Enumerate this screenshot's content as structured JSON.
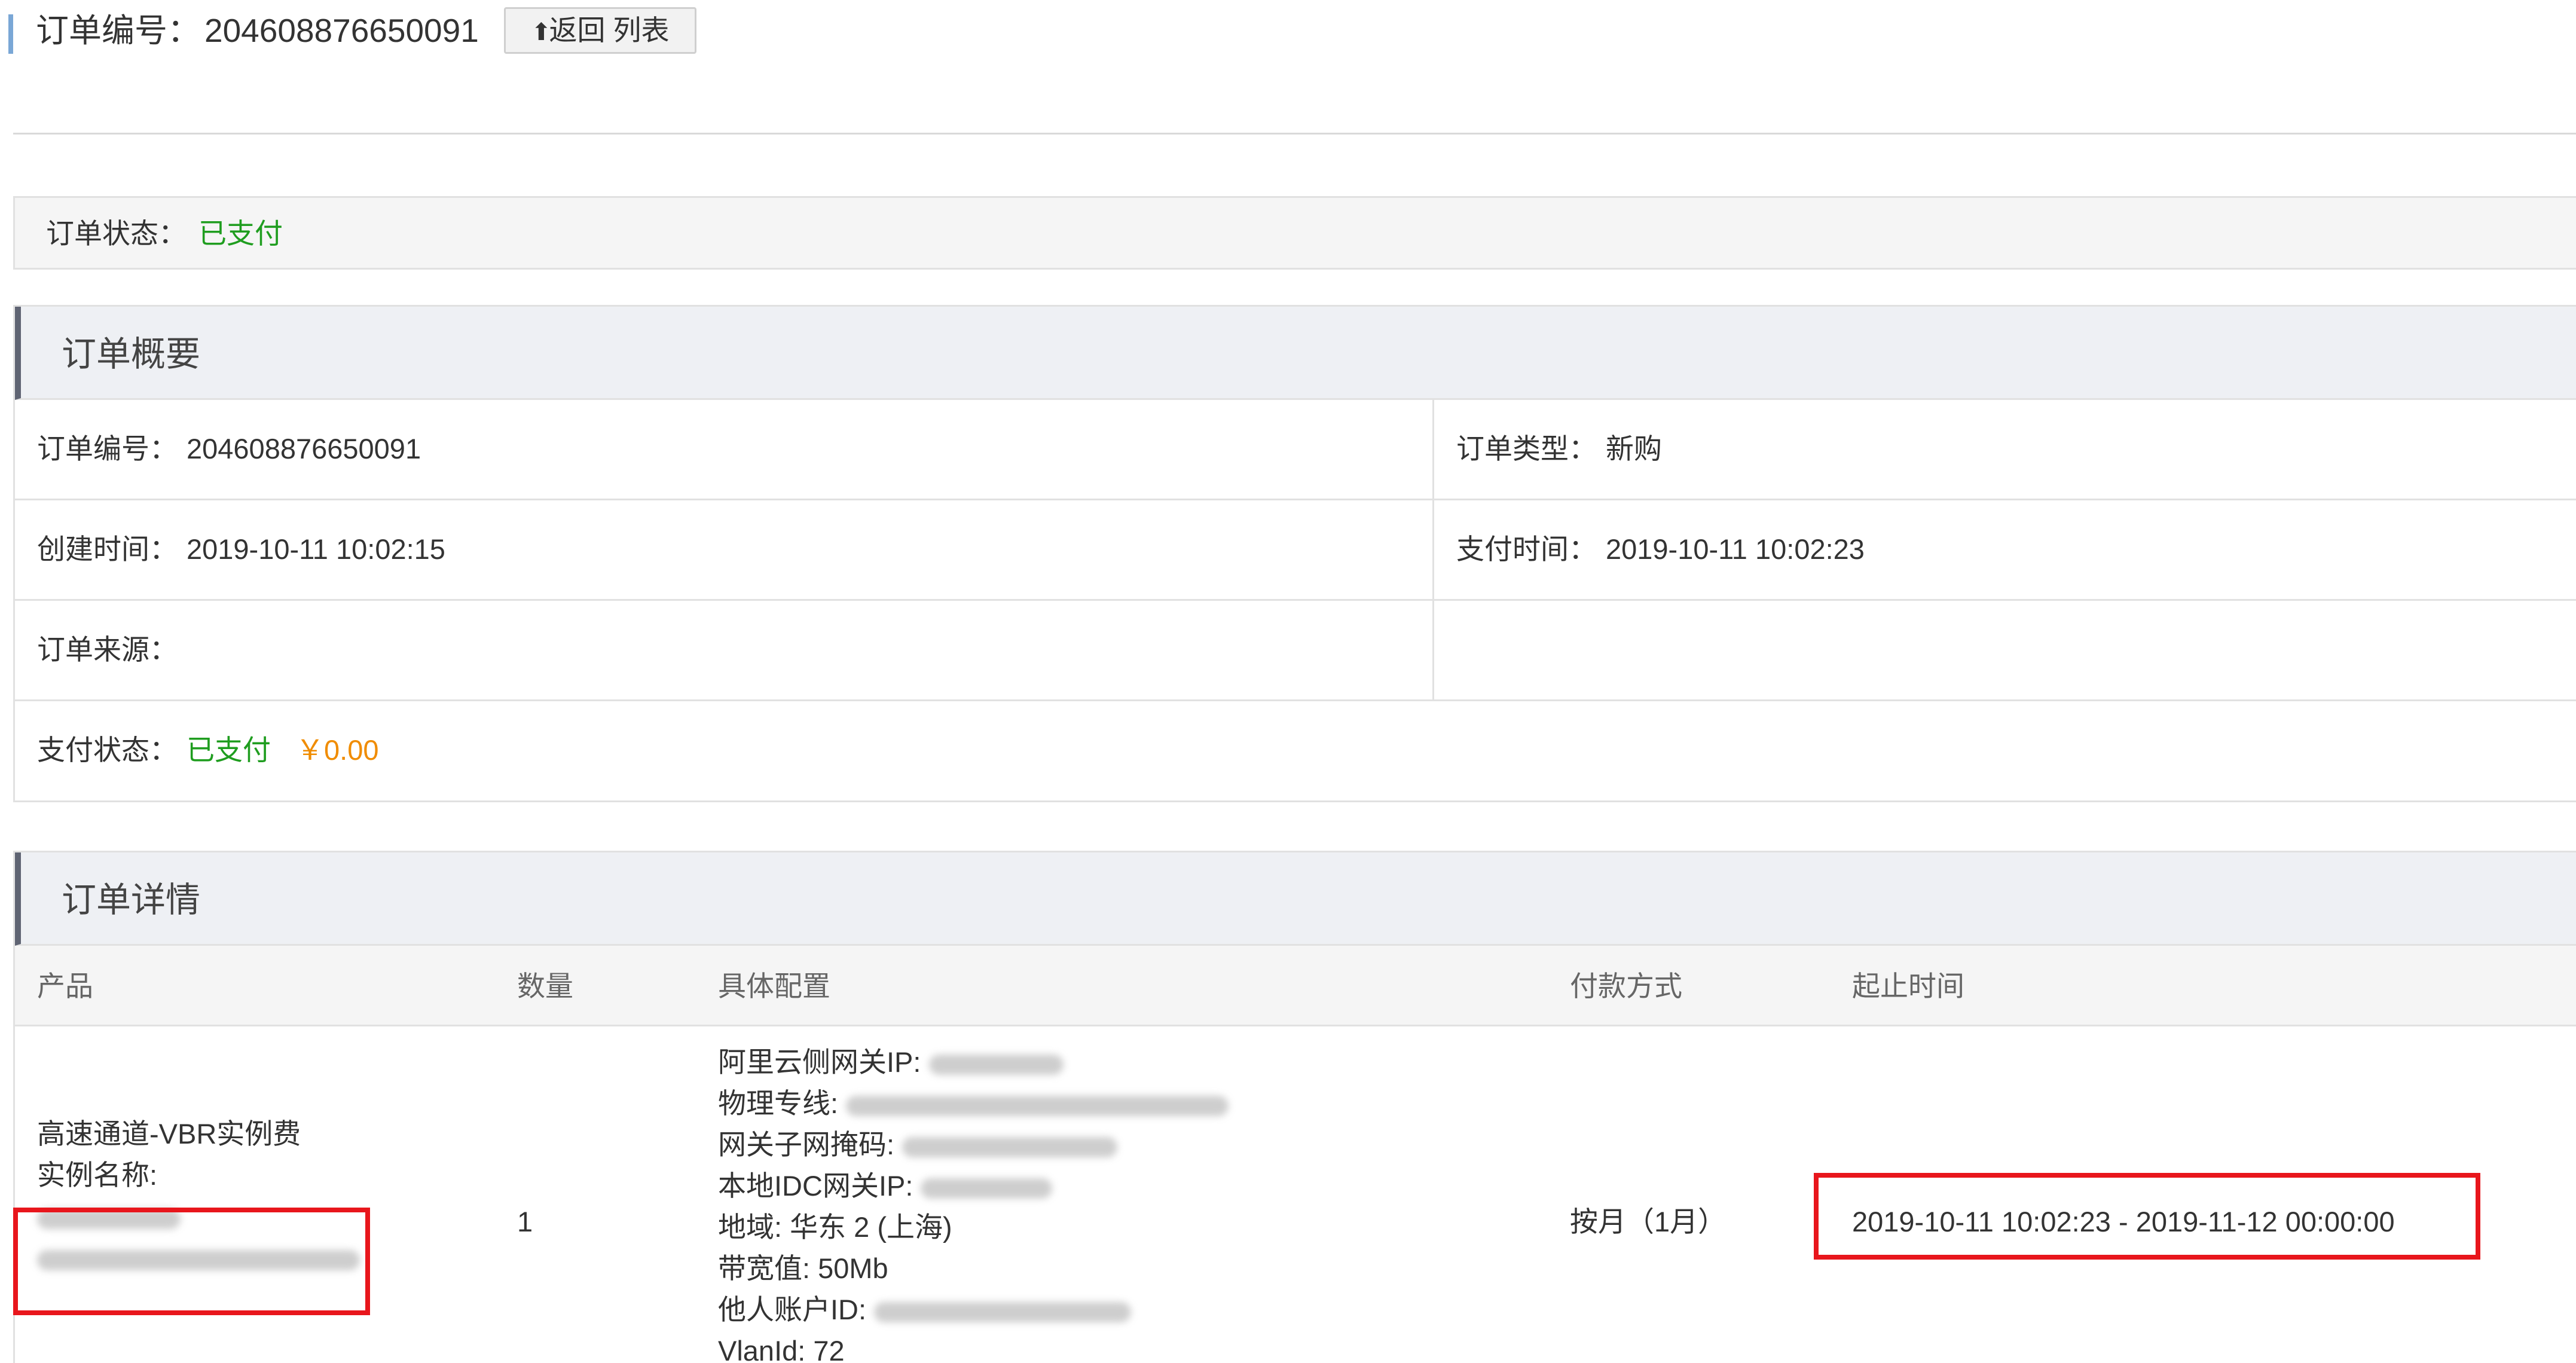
{
  "header": {
    "order_no_label": "订单编号：",
    "order_no": "204608876650091",
    "back_arrow": "⬆",
    "back_label": "返回 列表"
  },
  "status_bar": {
    "label": "订单状态：",
    "value": "已支付"
  },
  "summary": {
    "title": "订单概要",
    "order_no_label": "订单编号：",
    "order_no": "204608876650091",
    "order_type_label": "订单类型：",
    "order_type": "新购",
    "created_label": "创建时间：",
    "created": "2019-10-11 10:02:15",
    "paid_time_label": "支付时间：",
    "paid_time": "2019-10-11 10:02:23",
    "source_label": "订单来源：",
    "source": "",
    "pay_status_label": "支付状态：",
    "pay_status": "已支付",
    "amount": "￥0.00"
  },
  "detail": {
    "title": "订单详情",
    "columns": [
      "产品",
      "数量",
      "具体配置",
      "付款方式",
      "起止时间"
    ],
    "row": {
      "product": "高速通道-VBR实例费",
      "instance_label": "实例名称:",
      "quantity": "1",
      "config": {
        "gateway_ip_label": "阿里云侧网关IP:",
        "physical_line_label": "物理专线:",
        "subnet_mask_label": "网关子网掩码:",
        "idc_gateway_label": "本地IDC网关IP:",
        "region_label": "地域:",
        "region_value": "华东 2 (上海)",
        "bandwidth_label": "带宽值:",
        "bandwidth_value": "50Mb",
        "account_id_label": "他人账户ID:",
        "vlan_label": "VlanId:",
        "vlan_value": "72"
      },
      "payment": "按月（1月）",
      "period": "2019-10-11 10:02:23 - 2019-11-12 00:00:00"
    }
  },
  "colors": {
    "status_green": "#1f9d1f",
    "amount_orange": "#f08c00",
    "highlight_red": "#e8161c",
    "header_accent": "#7aa7d6"
  }
}
